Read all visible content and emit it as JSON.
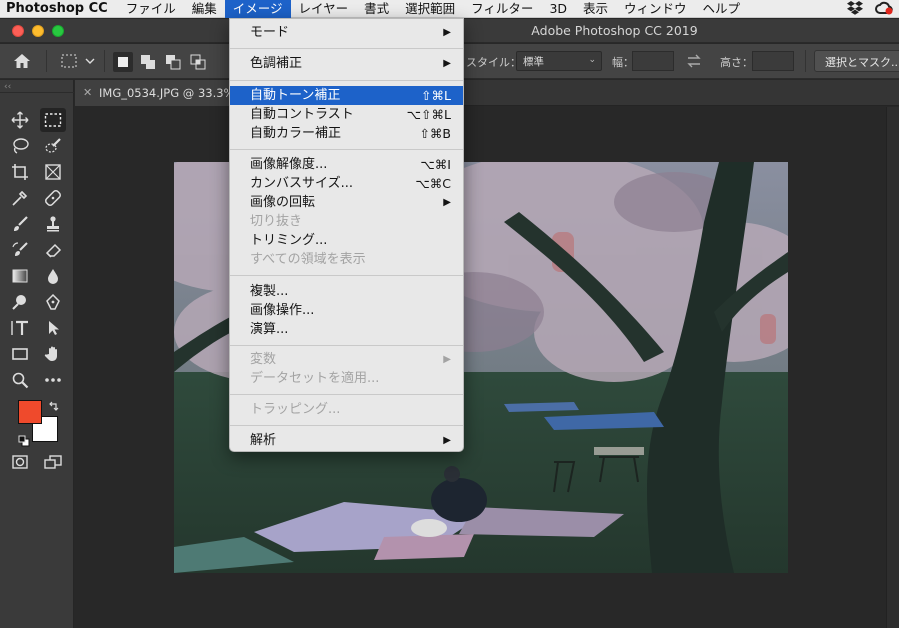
{
  "menubar": {
    "apple_icon": "apple-icon",
    "app_name": "Photoshop CC",
    "items": [
      {
        "label": "ファイル"
      },
      {
        "label": "編集"
      },
      {
        "label": "イメージ"
      },
      {
        "label": "レイヤー"
      },
      {
        "label": "書式"
      },
      {
        "label": "選択範囲"
      },
      {
        "label": "フィルター"
      },
      {
        "label": "3D"
      },
      {
        "label": "表示"
      },
      {
        "label": "ウィンドウ"
      },
      {
        "label": "ヘルプ"
      }
    ],
    "active_index": 2,
    "status_icons": [
      "dropbox-icon",
      "creative-cloud-icon"
    ]
  },
  "titlebar": {
    "title": "Adobe Photoshop CC 2019"
  },
  "options_bar": {
    "style_label": "スタイル：",
    "style_value": "標準",
    "width_label": "幅：",
    "height_label": "高さ：",
    "select_mask_label": "選択とマスク..."
  },
  "document": {
    "tab_title": "IMG_0534.JPG @ 33.3%"
  },
  "image_menu": {
    "items": [
      {
        "label": "モード",
        "shortcut": "",
        "submenu": true,
        "disabled": false
      },
      {
        "label": "色調補正",
        "shortcut": "",
        "submenu": true,
        "disabled": false
      },
      {
        "label": "自動トーン補正",
        "shortcut": "⇧⌘L",
        "submenu": false,
        "disabled": false,
        "highlighted": true
      },
      {
        "label": "自動コントラスト",
        "shortcut": "⌥⇧⌘L",
        "submenu": false,
        "disabled": false
      },
      {
        "label": "自動カラー補正",
        "shortcut": "⇧⌘B",
        "submenu": false,
        "disabled": false
      },
      {
        "label": "画像解像度...",
        "shortcut": "⌥⌘I",
        "submenu": false,
        "disabled": false
      },
      {
        "label": "カンバスサイズ...",
        "shortcut": "⌥⌘C",
        "submenu": false,
        "disabled": false
      },
      {
        "label": "画像の回転",
        "shortcut": "",
        "submenu": true,
        "disabled": false
      },
      {
        "label": "切り抜き",
        "shortcut": "",
        "submenu": false,
        "disabled": true
      },
      {
        "label": "トリミング...",
        "shortcut": "",
        "submenu": false,
        "disabled": false
      },
      {
        "label": "すべての領域を表示",
        "shortcut": "",
        "submenu": false,
        "disabled": true
      },
      {
        "label": "複製...",
        "shortcut": "",
        "submenu": false,
        "disabled": false
      },
      {
        "label": "画像操作...",
        "shortcut": "",
        "submenu": false,
        "disabled": false
      },
      {
        "label": "演算...",
        "shortcut": "",
        "submenu": false,
        "disabled": false
      },
      {
        "label": "変数",
        "shortcut": "",
        "submenu": true,
        "disabled": true
      },
      {
        "label": "データセットを適用...",
        "shortcut": "",
        "submenu": false,
        "disabled": true
      },
      {
        "label": "トラッピング...",
        "shortcut": "",
        "submenu": false,
        "disabled": true
      },
      {
        "label": "解析",
        "shortcut": "",
        "submenu": true,
        "disabled": false
      }
    ],
    "submenu_arrow": "▶"
  },
  "colors": {
    "foreground": "#ef4a2c",
    "background": "#ffffff",
    "highlight": "#1d62c9"
  }
}
